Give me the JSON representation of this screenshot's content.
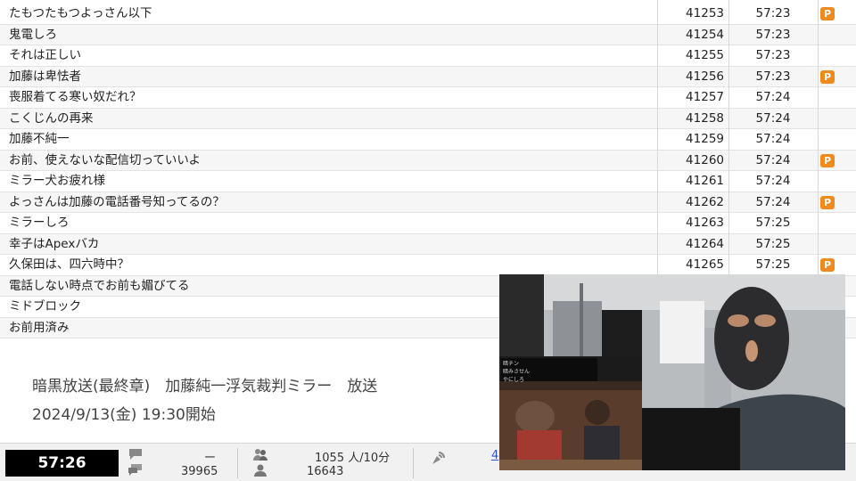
{
  "comments": [
    {
      "text": "たもつたもつよっさん以下",
      "number": "41253",
      "time": "57:23",
      "premium": true
    },
    {
      "text": "鬼電しろ",
      "number": "41254",
      "time": "57:23",
      "premium": false
    },
    {
      "text": "それは正しい",
      "number": "41255",
      "time": "57:23",
      "premium": false
    },
    {
      "text": "加藤は卑怯者",
      "number": "41256",
      "time": "57:23",
      "premium": true
    },
    {
      "text": "喪服着てる寒い奴だれ？",
      "number": "41257",
      "time": "57:24",
      "premium": false
    },
    {
      "text": "こくじんの再来",
      "number": "41258",
      "time": "57:24",
      "premium": false
    },
    {
      "text": "加藤不純一",
      "number": "41259",
      "time": "57:24",
      "premium": false
    },
    {
      "text": "お前、使えないな配信切っていいよ",
      "number": "41260",
      "time": "57:24",
      "premium": true
    },
    {
      "text": "ミラー犬お疲れ様",
      "number": "41261",
      "time": "57:24",
      "premium": false
    },
    {
      "text": "よっさんは加藤の電話番号知ってるの？",
      "number": "41262",
      "time": "57:24",
      "premium": true
    },
    {
      "text": "ミラーしろ",
      "number": "41263",
      "time": "57:25",
      "premium": false
    },
    {
      "text": "幸子はApexバカ",
      "number": "41264",
      "time": "57:25",
      "premium": false
    },
    {
      "text": "久保田は、四六時中？",
      "number": "41265",
      "time": "57:25",
      "premium": true
    },
    {
      "text": "電話しない時点でお前も媚びてる",
      "number": "",
      "time": "",
      "premium": false
    },
    {
      "text": "ミドブロック",
      "number": "",
      "time": "",
      "premium": false
    },
    {
      "text": "お前用済み",
      "number": "",
      "time": "",
      "premium": false
    }
  ],
  "premium_badge": "P",
  "program": {
    "title": "暗黒放送(最終章)　加藤純一浮気裁判ミラー　放送",
    "start": "2024/9/13(金) 19:30開始"
  },
  "status": {
    "elapsed": "57:26",
    "comment_rate": "ー",
    "comment_total": "39965",
    "viewers_rate": "1055 人/10分",
    "viewers_total": "16643",
    "link_text": "4"
  },
  "video_inset_lines": [
    "暗チン",
    "暗みさせん",
    "やにしろ"
  ],
  "colors": {
    "premium": "#f08a1c",
    "elapsed_bg": "#000000",
    "link": "#2a55c8"
  },
  "icons": [
    "comment-icon",
    "comments-stack-icon",
    "user-group-icon",
    "user-icon",
    "broadcast-icon"
  ]
}
